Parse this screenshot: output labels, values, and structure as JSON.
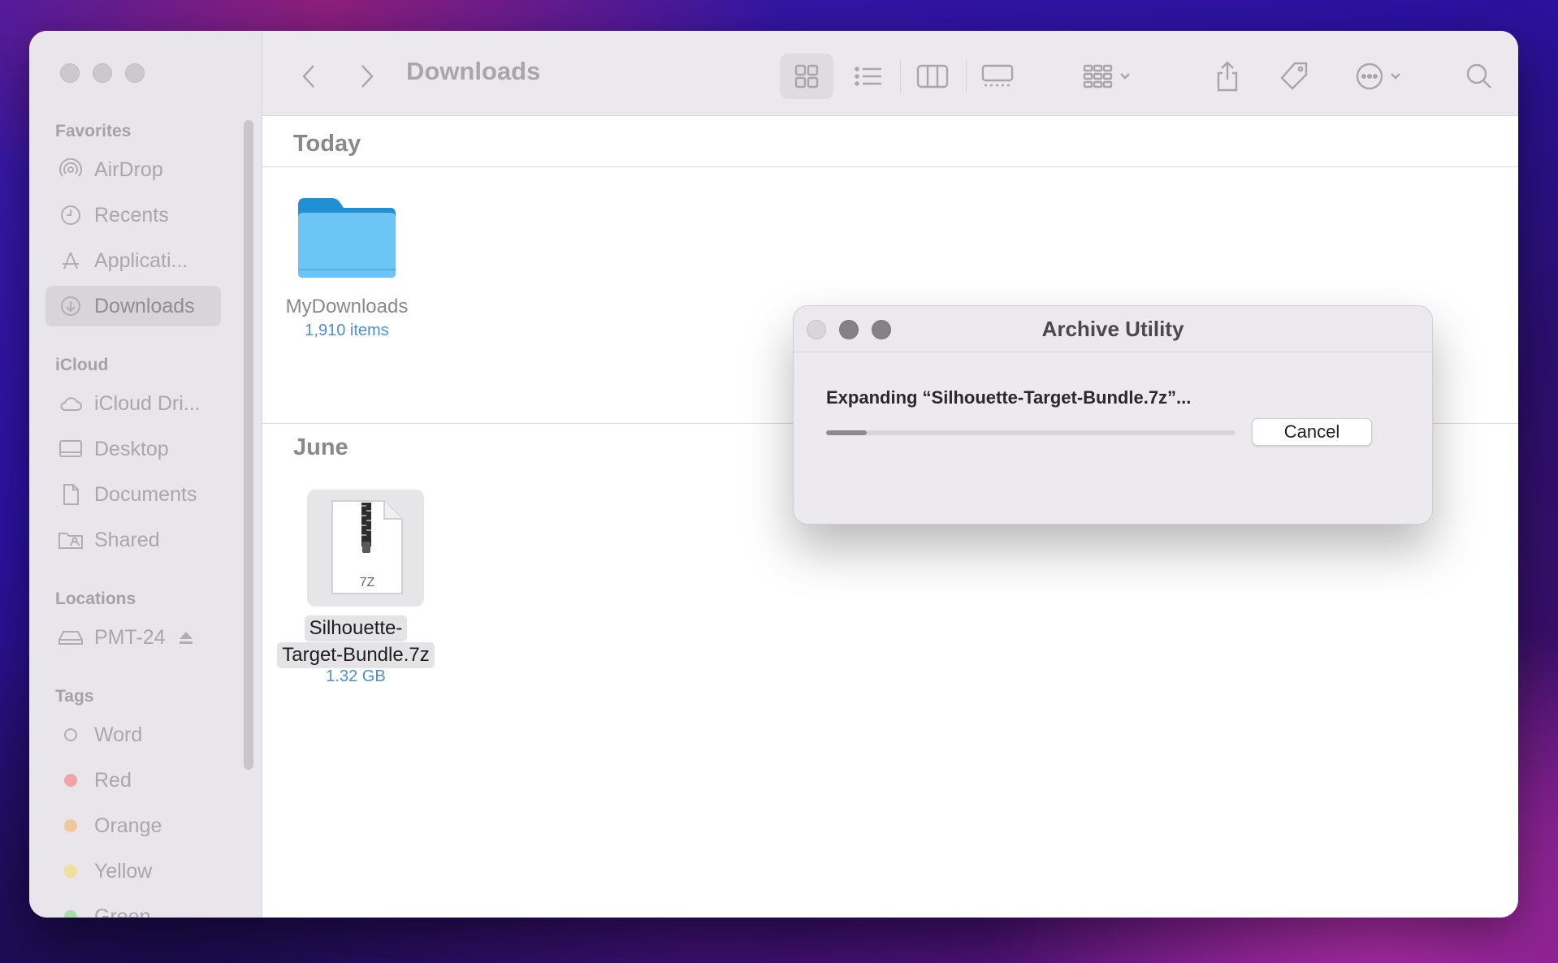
{
  "window": {
    "title": "Downloads"
  },
  "sidebar": {
    "sections": {
      "favorites": "Favorites",
      "icloud": "iCloud",
      "locations": "Locations",
      "tags": "Tags"
    },
    "favorites": [
      {
        "label": "AirDrop",
        "icon": "airdrop-icon"
      },
      {
        "label": "Recents",
        "icon": "clock-icon"
      },
      {
        "label": "Applicati...",
        "icon": "applications-icon"
      },
      {
        "label": "Downloads",
        "icon": "download-icon",
        "selected": true
      }
    ],
    "icloud": [
      {
        "label": "iCloud Dri...",
        "icon": "cloud-icon"
      },
      {
        "label": "Desktop",
        "icon": "desktop-icon"
      },
      {
        "label": "Documents",
        "icon": "document-icon"
      },
      {
        "label": "Shared",
        "icon": "shared-folder-icon"
      }
    ],
    "locations": [
      {
        "label": "PMT-24",
        "icon": "drive-icon"
      }
    ],
    "tags": [
      {
        "label": "Word",
        "color": "hollow"
      },
      {
        "label": "Red",
        "color": "#f2a3a6"
      },
      {
        "label": "Orange",
        "color": "#f0c89a"
      },
      {
        "label": "Yellow",
        "color": "#f0e09a"
      },
      {
        "label": "Green",
        "color": "#a6dfa8"
      }
    ]
  },
  "content": {
    "groups": [
      {
        "heading": "Today",
        "items": [
          {
            "name": "MyDownloads",
            "meta": "1,910 items",
            "icon": "folder-icon"
          }
        ]
      },
      {
        "heading": "June",
        "items": [
          {
            "name_line1": "Silhouette-",
            "name_line2": "Target-Bundle.7z",
            "meta": "1.32 GB",
            "icon": "archive-7z-icon",
            "badge": "7Z"
          }
        ]
      }
    ]
  },
  "dialog": {
    "title": "Archive Utility",
    "message": "Expanding “Silhouette-Target-Bundle.7z”...",
    "progress_fraction": 0.1,
    "cancel_label": "Cancel"
  }
}
